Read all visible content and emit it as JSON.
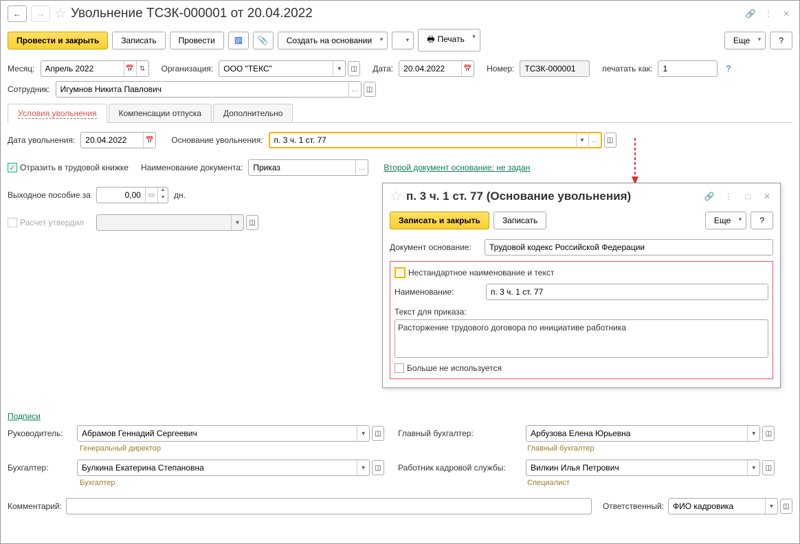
{
  "titlebar": {
    "title": "Увольнение ТСЗК-000001 от 20.04.2022"
  },
  "toolbar": {
    "post_close": "Провести и закрыть",
    "save": "Записать",
    "post": "Провести",
    "create_based": "Создать на основании",
    "print": "Печать",
    "more": "Еще",
    "help": "?"
  },
  "header": {
    "month_label": "Месяц:",
    "month_value": "Апрель 2022",
    "org_label": "Организация:",
    "org_value": "ООО \"ТЕКС\"",
    "date_label": "Дата:",
    "date_value": "20.04.2022",
    "number_label": "Номер:",
    "number_value": "ТСЗК-000001",
    "print_as_label": "печатать как:",
    "print_as_value": "1",
    "help": "?",
    "employee_label": "Сотрудник:",
    "employee_value": "Игумнов Никита Павлович"
  },
  "tabs": {
    "cond": "Условия увольнения",
    "vac": "Компенсации отпуска",
    "extra": "Дополнительно"
  },
  "cond": {
    "dismiss_date_label": "Дата увольнения:",
    "dismiss_date_value": "20.04.2022",
    "reason_label": "Основание увольнения:",
    "reason_value": "п. 3 ч. 1 ст. 77",
    "workbook_check": "Отразить в трудовой книжке",
    "doc_name_label": "Наименование документа:",
    "doc_name_value": "Приказ",
    "second_doc_link": "Второй документ основание: не задан",
    "severance_label": "Выходное пособие за",
    "severance_value": "0,00",
    "severance_unit": "дн.",
    "approved_label": "Расчет утвердил"
  },
  "popup": {
    "title": "п. 3 ч. 1 ст. 77 (Основание увольнения)",
    "save_close": "Записать и закрыть",
    "save": "Записать",
    "more": "Еще",
    "help": "?",
    "doc_basis_label": "Документ основание:",
    "doc_basis_value": "Трудовой кодекс Российской Федерации",
    "nonstd_check": "Нестандартное наименование и текст",
    "name_label": "Наименование:",
    "name_value": "п. 3 ч. 1 ст. 77",
    "order_text_label": "Текст для приказа:",
    "order_text_value": "Расторжение трудового договора по инициативе работника",
    "unused_check": "Больше не используется"
  },
  "signatures": {
    "link": "Подписи",
    "head_label": "Руководитель:",
    "head_value": "Абрамов Геннадий Сергеевич",
    "head_title": "Генеральный директор",
    "chief_acc_label": "Главный бухгалтер:",
    "chief_acc_value": "Арбузова Елена Юрьевна",
    "chief_acc_title": "Главный бухгалтер",
    "acc_label": "Бухгалтер:",
    "acc_value": "Булкина Екатерина Степановна",
    "acc_title": "Бухгалтер",
    "hr_label": "Работник кадровой службы:",
    "hr_value": "Вилкин Илья Петрович",
    "hr_title": "Специалист"
  },
  "footer": {
    "comment_label": "Комментарий:",
    "comment_value": "",
    "resp_label": "Ответственный:",
    "resp_value": "ФИО кадровика"
  }
}
